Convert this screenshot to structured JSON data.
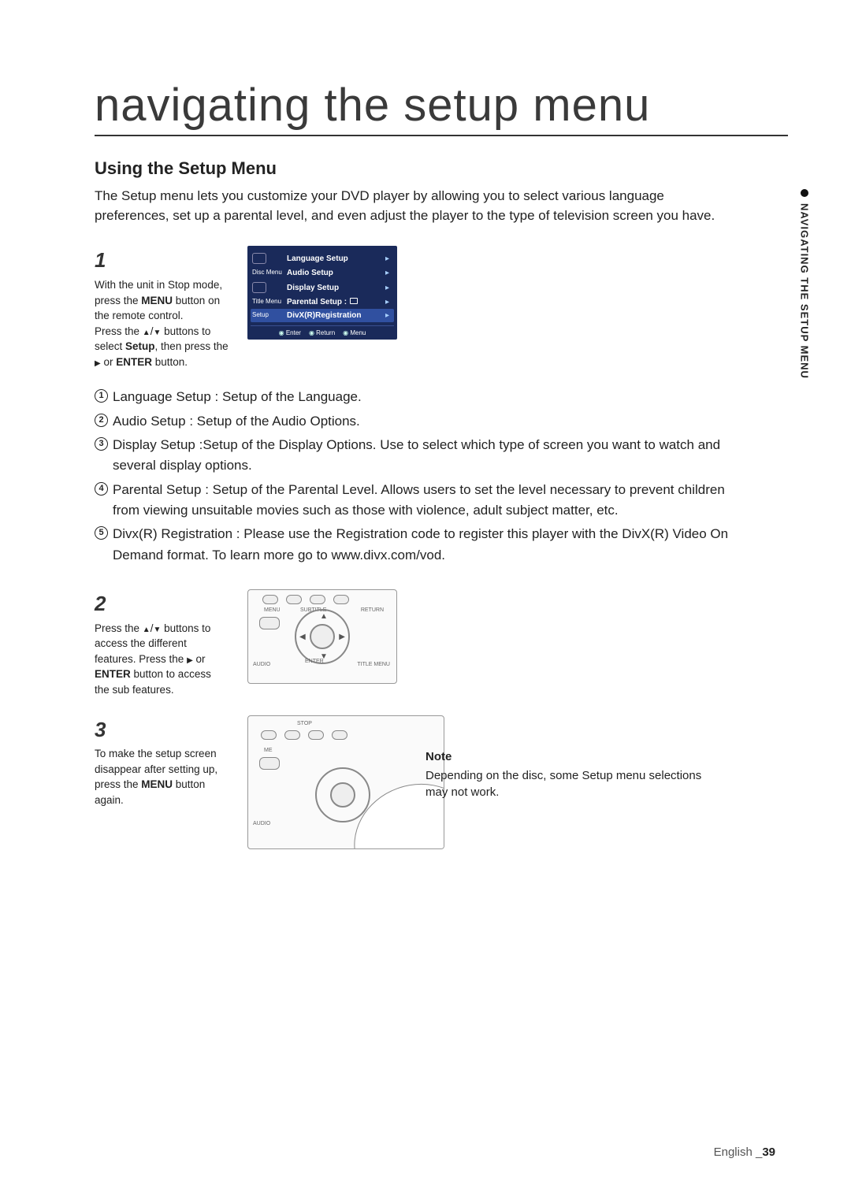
{
  "title": "navigating the setup menu",
  "section_heading": "Using the Setup Menu",
  "intro": "The Setup menu lets you customize your DVD player by allowing you to select various language preferences, set up a parental level, and even adjust the player to the type of television screen you have.",
  "side_tab": "NAVIGATING THE SETUP MENU",
  "step1": {
    "num": "1",
    "l1": "With the unit in Stop mode, press the ",
    "menu": "MENU",
    "l2": " button on the remote control.",
    "l3": "Press the ",
    "l4": " buttons to select ",
    "setup": "Setup",
    "l5": ", then press the ",
    "l6": " or ",
    "enter": "ENTER",
    "l7": " button."
  },
  "osd": {
    "left": {
      "disc": "Disc Menu",
      "title": "Title Menu",
      "setup": "Setup"
    },
    "items": {
      "lang": "Language Setup",
      "audio": "Audio Setup",
      "display": "Display Setup",
      "parental": "Parental Setup :",
      "divx": "DivX(R)Registration"
    },
    "footer": {
      "enter": "Enter",
      "ret": "Return",
      "menu": "Menu"
    }
  },
  "desc": {
    "d1": "Language Setup : Setup of the Language.",
    "d2": "Audio Setup : Setup of the Audio Options.",
    "d3": "Display Setup :Setup of the Display Options. Use to select which type of screen you want to watch and several display options.",
    "d4": "Parental Setup : Setup of the Parental Level. Allows users to set the level necessary to prevent children from viewing unsuitable movies such as those with violence, adult subject matter, etc.",
    "d5": "Divx(R) Registration : Please use the Registration code to register this player with the DivX(R) Video On Demand format. To learn more go to www.divx.com/vod."
  },
  "step2": {
    "num": "2",
    "l1": "Press the ",
    "l2": " buttons to access the different features. Press the ",
    "l3": " or ",
    "enter": "ENTER",
    "l4": " button to access the sub features."
  },
  "step3": {
    "num": "3",
    "l1": "To make the setup screen disappear after setting up, press the ",
    "menu": "MENU",
    "l2": " button again."
  },
  "remote_labels": {
    "menu": "MENU",
    "subtitle": "SUBTITLE",
    "return": "RETURN",
    "audio": "AUDIO",
    "enter": "ENTER",
    "title_menu": "TITLE MENU",
    "stop": "STOP"
  },
  "note": {
    "title": "Note",
    "body": "Depending on the disc, some Setup menu selections may not work."
  },
  "footer": {
    "lang": "English ",
    "sep": "_",
    "page": "39"
  }
}
